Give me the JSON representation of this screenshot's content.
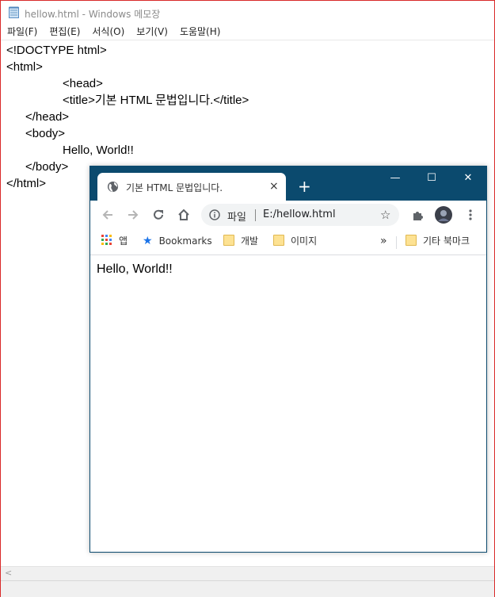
{
  "notepad": {
    "title": "hellow.html - Windows 메모장",
    "menu": [
      "파일(F)",
      "편집(E)",
      "서식(O)",
      "보기(V)",
      "도움말(H)"
    ],
    "lines": [
      "<!DOCTYPE html>",
      "<html>",
      "<head>",
      "<title>기본 HTML 문법입니다.</title>",
      "</head>",
      "<body>",
      "Hello, World!!",
      "</body>",
      "</html>"
    ],
    "scroll_arrow": "<"
  },
  "chrome": {
    "tab_title": "기본 HTML 문법입니다.",
    "tab_close": "×",
    "new_tab": "+",
    "window_buttons": {
      "minimize": "—",
      "maximize": "☐",
      "close": "✕"
    },
    "address": {
      "scheme_label": "파일",
      "url": "E:/hellow.html",
      "star": "☆"
    },
    "bookmarks": {
      "apps": "앱",
      "bookmarks": "Bookmarks",
      "folder1": "개발",
      "folder2": "이미지",
      "more": "»",
      "other": "기타 북마크"
    },
    "page_text": "Hello, World!!"
  }
}
